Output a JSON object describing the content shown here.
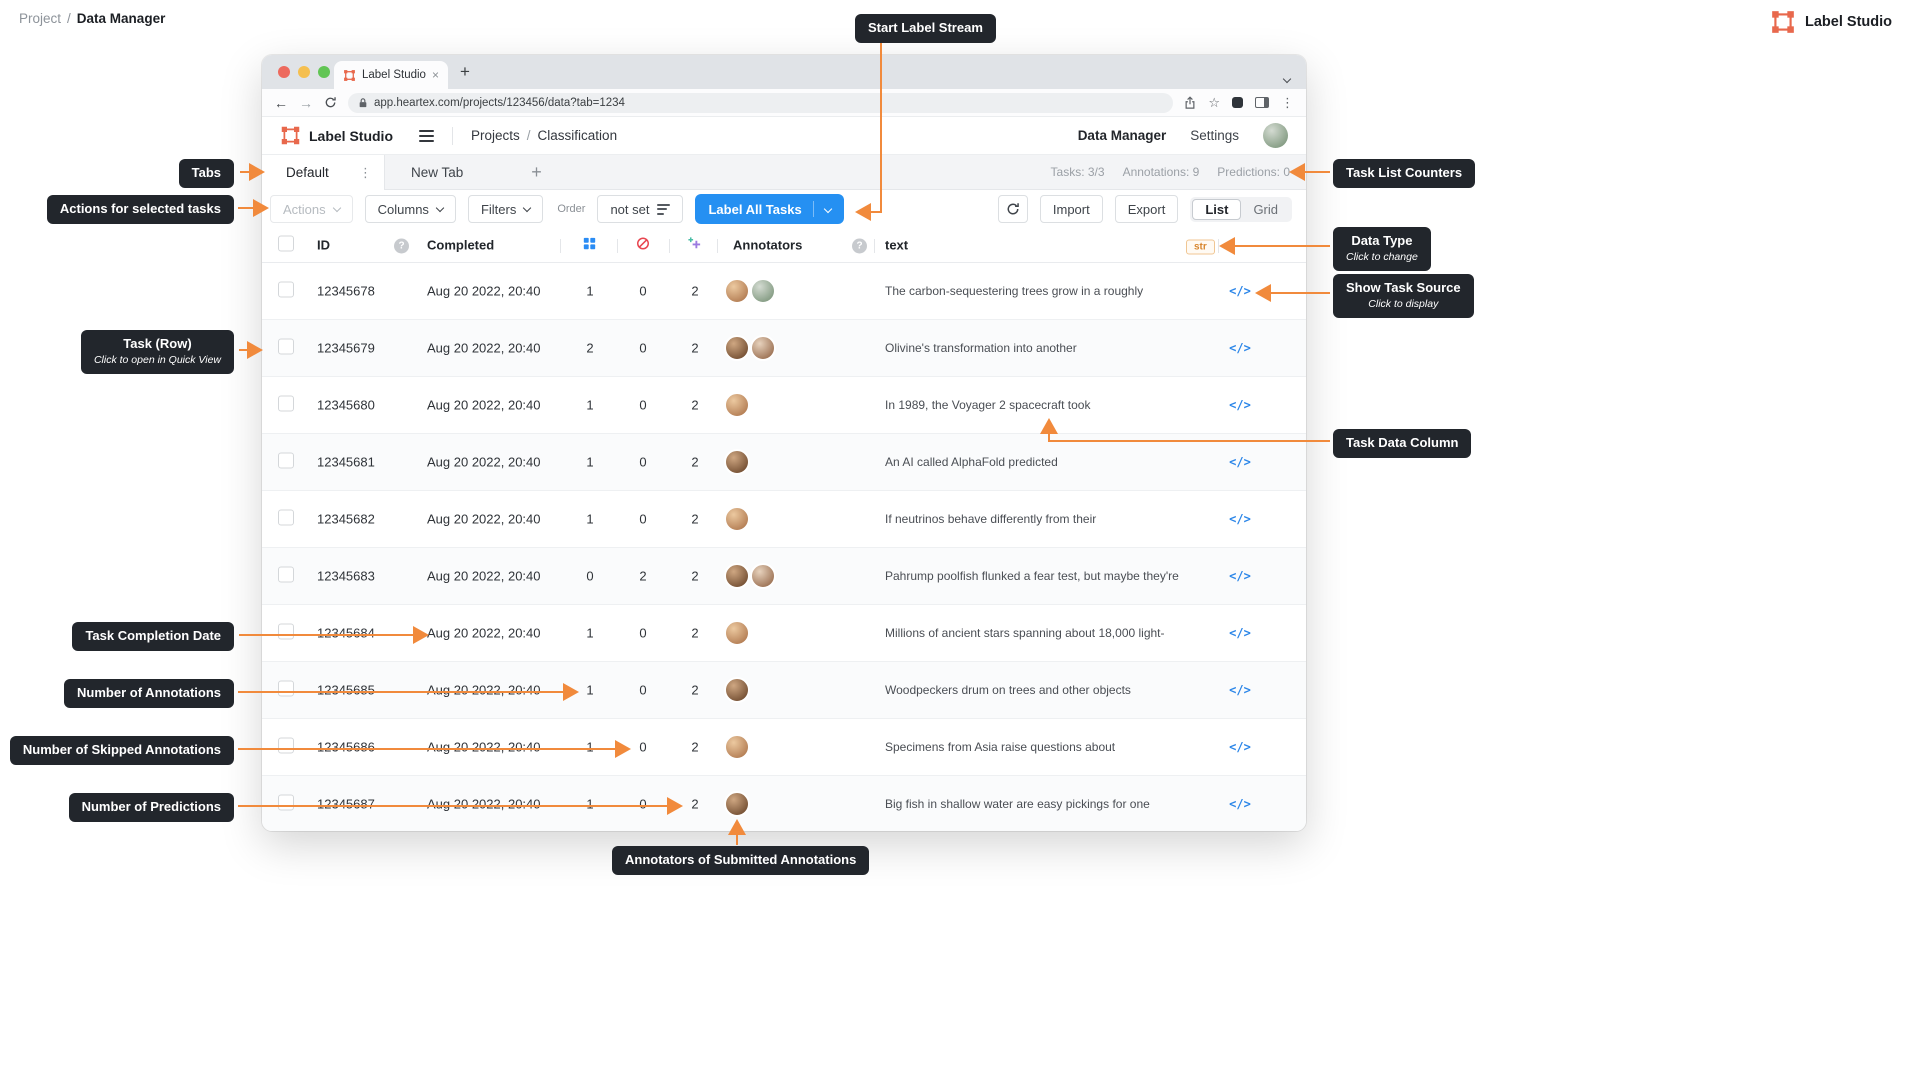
{
  "page": {
    "breadcrumb": {
      "root": "Project",
      "separator": "/",
      "current": "Data Manager"
    },
    "brand": "Label Studio"
  },
  "colors": {
    "callout_bg": "#22262C",
    "arrow_orange": "#F18A3C",
    "primary_blue": "#2590F2",
    "logo_coral": "#E8684C",
    "code_icon_blue": "#2A85E8",
    "skipped_red": "#E8454F",
    "annotations_blue": "#2A8CF4",
    "predictions_purple": "#9B7BE0",
    "type_badge_orange": "#D8862E"
  },
  "callouts": {
    "start_label_stream": "Start Label Stream",
    "tabs": "Tabs",
    "actions": "Actions for selected tasks",
    "task_list_counters": "Task List Counters",
    "data_type": {
      "title": "Data Type",
      "subtitle": "Click to change"
    },
    "show_task_source": {
      "title": "Show Task Source",
      "subtitle": "Click to display"
    },
    "task_row": {
      "title": "Task (Row)",
      "subtitle": "Click to open in Quick View"
    },
    "task_data_column": "Task Data Column",
    "task_completion_date": "Task Completion Date",
    "number_of_annotations": "Number of Annotations",
    "number_of_skipped": "Number of Skipped Annotations",
    "number_of_predictions": "Number of Predictions",
    "annotators_submitted": "Annotators of Submitted Annotations"
  },
  "browser": {
    "tab_title": "Label Studio",
    "tab_close": "×",
    "new_tab": "+",
    "url": "app.heartex.com/projects/123456/data?tab=1234",
    "back": "←",
    "forward": "→",
    "star": "☆",
    "kebab": "⋮"
  },
  "app": {
    "header": {
      "brand": "Label Studio",
      "nav_root": "Projects",
      "nav_separator": "/",
      "nav_current": "Classification",
      "link_data_manager": "Data Manager",
      "link_settings": "Settings"
    },
    "tabs": {
      "active": "Default",
      "active_menu": "⋮",
      "second": "New Tab",
      "add": "+",
      "counters": {
        "tasks": "Tasks: 3/3",
        "annotations": "Annotations: 9",
        "predictions": "Predictions: 0"
      }
    },
    "toolbar": {
      "actions": "Actions",
      "columns": "Columns",
      "filters": "Filters",
      "order_label": "Order",
      "order_value": "not set",
      "label_all": "Label All Tasks",
      "import": "Import",
      "export": "Export",
      "view_list": "List",
      "view_grid": "Grid"
    },
    "table": {
      "headers": {
        "id": "ID",
        "completed": "Completed",
        "annotators": "Annotators",
        "text": "text"
      },
      "data_type_badge": "str",
      "source_icon": "</>",
      "rows": [
        {
          "id": "12345678",
          "completed": "Aug 20 2022, 20:40",
          "annotations": "1",
          "skipped": "0",
          "predictions": "2",
          "annotators": 2,
          "text": "The carbon-sequestering trees grow in a roughly"
        },
        {
          "id": "12345679",
          "completed": "Aug 20 2022, 20:40",
          "annotations": "2",
          "skipped": "0",
          "predictions": "2",
          "annotators": 2,
          "text": "Olivine's transformation into another"
        },
        {
          "id": "12345680",
          "completed": "Aug 20 2022, 20:40",
          "annotations": "1",
          "skipped": "0",
          "predictions": "2",
          "annotators": 1,
          "text": "In 1989, the Voyager 2 spacecraft took"
        },
        {
          "id": "12345681",
          "completed": "Aug 20 2022, 20:40",
          "annotations": "1",
          "skipped": "0",
          "predictions": "2",
          "annotators": 1,
          "text": "An AI called AlphaFold predicted"
        },
        {
          "id": "12345682",
          "completed": "Aug 20 2022, 20:40",
          "annotations": "1",
          "skipped": "0",
          "predictions": "2",
          "annotators": 1,
          "text": "If neutrinos behave differently from their"
        },
        {
          "id": "12345683",
          "completed": "Aug 20 2022, 20:40",
          "annotations": "0",
          "skipped": "2",
          "predictions": "2",
          "annotators": 2,
          "text": "Pahrump poolfish flunked a fear test, but maybe they're"
        },
        {
          "id": "12345684",
          "completed": "Aug 20 2022, 20:40",
          "annotations": "1",
          "skipped": "0",
          "predictions": "2",
          "annotators": 1,
          "text": "Millions of ancient stars spanning about 18,000 light-"
        },
        {
          "id": "12345685",
          "completed": "Aug 20 2022, 20:40",
          "annotations": "1",
          "skipped": "0",
          "predictions": "2",
          "annotators": 1,
          "text": "Woodpeckers drum on trees and other objects"
        },
        {
          "id": "12345686",
          "completed": "Aug 20 2022, 20:40",
          "annotations": "1",
          "skipped": "0",
          "predictions": "2",
          "annotators": 1,
          "text": "Specimens from Asia raise questions about"
        },
        {
          "id": "12345687",
          "completed": "Aug 20 2022, 20:40",
          "annotations": "1",
          "skipped": "0",
          "predictions": "2",
          "annotators": 1,
          "text": "Big fish in shallow water are easy pickings for one"
        }
      ]
    }
  }
}
